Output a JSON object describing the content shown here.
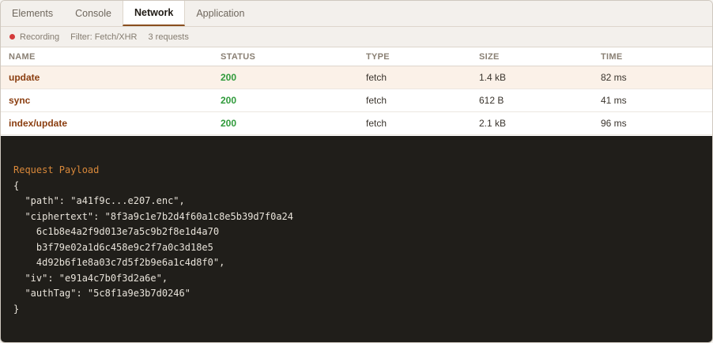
{
  "tabs": [
    {
      "label": "Elements"
    },
    {
      "label": "Console"
    },
    {
      "label": "Network"
    },
    {
      "label": "Application"
    }
  ],
  "active_tab": "Network",
  "toolbar": {
    "recording": "Recording",
    "filter": "Filter: Fetch/XHR",
    "count": "3 requests",
    "recording_color": "#d43b3b"
  },
  "table": {
    "headers": {
      "name": "NAME",
      "status": "STATUS",
      "type": "TYPE",
      "size": "SIZE",
      "time": "TIME"
    },
    "rows": [
      {
        "name": "update",
        "status": "200",
        "type": "fetch",
        "size": "1.4 kB",
        "time": "82 ms",
        "selected": true
      },
      {
        "name": "sync",
        "status": "200",
        "type": "fetch",
        "size": "612 B",
        "time": "41 ms",
        "selected": false
      },
      {
        "name": "index/update",
        "status": "200",
        "type": "fetch",
        "size": "2.1 kB",
        "time": "96 ms",
        "selected": false
      }
    ]
  },
  "payload": {
    "heading": "Request Payload",
    "lines": [
      "{",
      "  \"path\": \"a41f9c...e207.enc\",",
      "  \"ciphertext\": \"8f3a9c1e7b2d4f60a1c8e5b39d7f0a24",
      "    6c1b8e4a2f9d013e7a5c9b2f8e1d4a70",
      "    b3f79e02a1d6c458e9c2f7a0c3d18e5",
      "    4d92b6f1e8a03c7d5f2b9e6a1c4d8f0\",",
      "  \"iv\": \"e91a4c7b0f3d2a6e\",",
      "  \"authTag\": \"5c8f1a9e3b7d0246\"",
      "}"
    ]
  },
  "colors": {
    "accent": "#8a4e1e",
    "name_text": "#8a3d0f",
    "status_ok": "#2f9a3a",
    "payload_bg": "#201e1a",
    "payload_heading": "#d8883a"
  }
}
